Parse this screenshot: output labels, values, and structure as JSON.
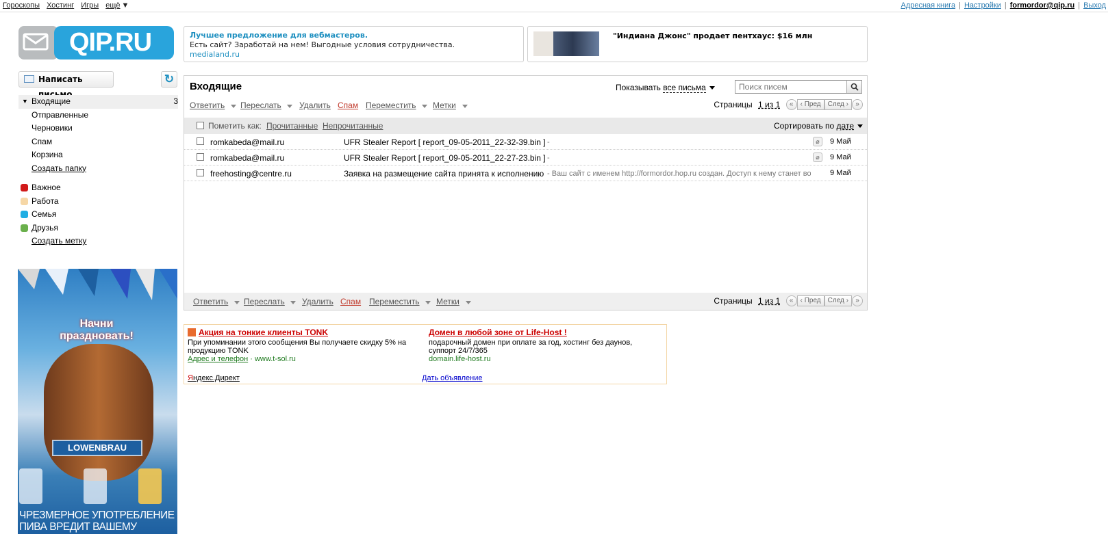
{
  "topbar": {
    "left": [
      "Гороскопы",
      "Хостинг",
      "Игры"
    ],
    "more": "ещё",
    "address_book": "Адресная книга",
    "settings": "Настройки",
    "user": "formordor@qip.ru",
    "logout": "Выход"
  },
  "logo": {
    "text": "QIP.RU"
  },
  "promo1": {
    "title": "Лучшее предложение для вебмастеров.",
    "desc": "Есть сайт? Заработай на нем! Выгодные условия сотрудничества.",
    "url": "medialand.ru"
  },
  "promo2": {
    "title": "\"Индиана Джонс\" продает пентхаус: $16 млн"
  },
  "compose": {
    "label": "Написать письмо"
  },
  "folders": [
    {
      "label": "Входящие",
      "count": "3"
    },
    {
      "label": "Отправленные"
    },
    {
      "label": "Черновики"
    },
    {
      "label": "Спам"
    },
    {
      "label": "Корзина"
    }
  ],
  "create_folder": "Создать папку",
  "labels": [
    {
      "label": "Важное",
      "color": "#d11a1a"
    },
    {
      "label": "Работа",
      "color": "#f6d7a6"
    },
    {
      "label": "Семья",
      "color": "#20aee3"
    },
    {
      "label": "Друзья",
      "color": "#6ab04c"
    }
  ],
  "create_label": "Создать метку",
  "banner": {
    "headline": "Начни праздновать!",
    "brand": "LOWENBRAU",
    "warning": "ЧРЕЗМЕРНОЕ УПОТРЕБЛЕНИЕ ПИВА ВРЕДИТ ВАШЕМУ ЗДОРОВЬЮ"
  },
  "mailbox": {
    "title": "Входящие",
    "show_label": "Показывать",
    "show_value": "все письма",
    "search_placeholder": "Поиск писем",
    "actions": {
      "reply": "Ответить",
      "forward": "Переслать",
      "delete": "Удалить",
      "spam": "Спам",
      "move": "Переместить",
      "tags": "Метки"
    },
    "pages_label": "Страницы",
    "pages_value": "1 из 1",
    "prev": "Пред",
    "next": "След",
    "mark_as": "Пометить как:",
    "mark_read": "Прочитанные",
    "mark_unread": "Непрочитанные",
    "sort_label": "Сортировать по",
    "sort_value": "дате",
    "messages": [
      {
        "from": "romkabeda@mail.ru",
        "subject": "UFR Stealer Report [ report_09-05-2011_22-32-39.bin ]",
        "snippet": "-",
        "attachment": true,
        "date": "9 Май"
      },
      {
        "from": "romkabeda@mail.ru",
        "subject": "UFR Stealer Report [ report_09-05-2011_22-27-23.bin ]",
        "snippet": "-",
        "attachment": true,
        "date": "9 Май"
      },
      {
        "from": "freehosting@centre.ru",
        "subject": "Заявка на размещение сайта принята к исполнению",
        "snippet": "- Ваш сайт с именем http://formordor.hop.ru создан. Доступ к нему станет возмо",
        "attachment": false,
        "date": "9 Май"
      }
    ]
  },
  "direct": {
    "ad1": {
      "title": "Акция на тонкие клиенты TONK",
      "desc": "При упоминании этого сообщения Вы получаете скидку 5% на продукцию TONK",
      "address": "Адрес и телефон",
      "url": "www.t-sol.ru"
    },
    "ad2": {
      "title": "Домен в любой зоне от Life-Host !",
      "desc": "подарочный домен при оплате за год, хостинг без даунов, суппорт 24/7/365",
      "url": "domain.life-host.ru"
    },
    "yandex_y": "Я",
    "yandex_rest": "ндекс.Директ",
    "advertise": "Дать объявление"
  },
  "colors": {
    "accent": "#29a4dc",
    "link": "#2a7ab0",
    "spam": "#c0392b"
  }
}
